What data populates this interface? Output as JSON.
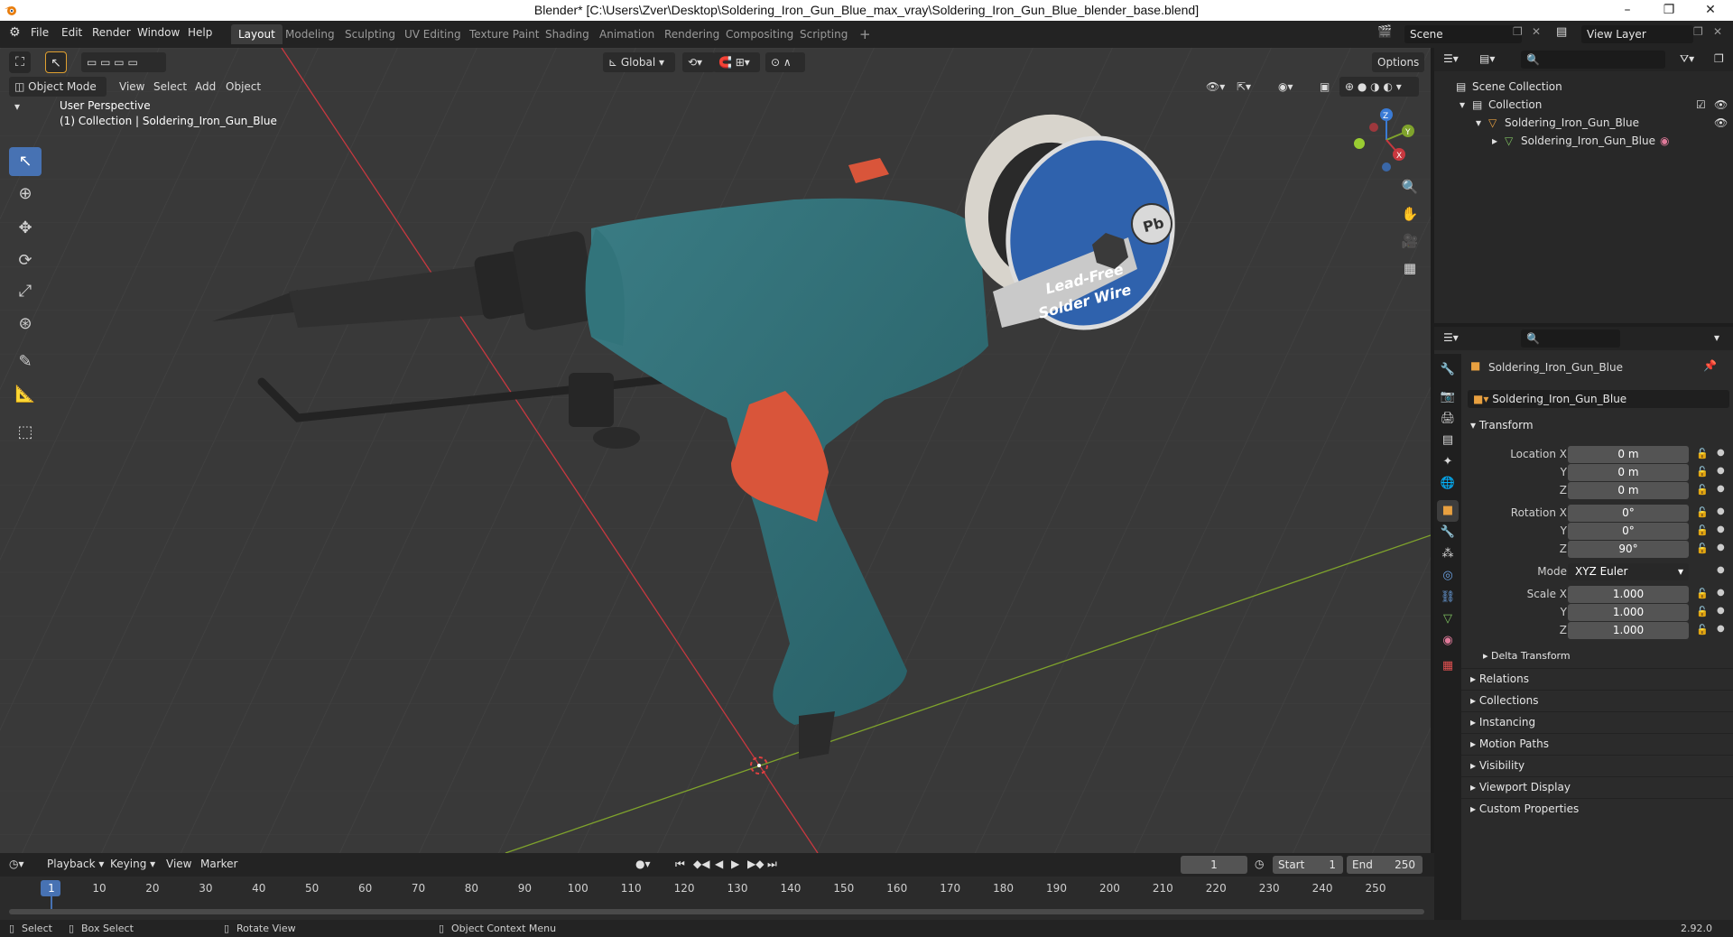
{
  "window": {
    "title": "Blender* [C:\\Users\\Zver\\Desktop\\Soldering_Iron_Gun_Blue_max_vray\\Soldering_Iron_Gun_Blue_blender_base.blend]",
    "minimize": "–",
    "restore": "❐",
    "close": "✕"
  },
  "menu": [
    "File",
    "Edit",
    "Render",
    "Window",
    "Help"
  ],
  "workspaces": [
    "Layout",
    "Modeling",
    "Sculpting",
    "UV Editing",
    "Texture Paint",
    "Shading",
    "Animation",
    "Rendering",
    "Compositing",
    "Scripting"
  ],
  "add_workspace": "+",
  "scene": {
    "name": "Scene",
    "view_layer": "View Layer"
  },
  "viewport": {
    "mode": "Object Mode",
    "menus": [
      "View",
      "Select",
      "Add",
      "Object"
    ],
    "transform_orientation": "Global",
    "options_label": "Options",
    "overlay_text": "User Perspective",
    "collection_text": "(1) Collection | Soldering_Iron_Gun_Blue",
    "axes": {
      "x": "X",
      "y": "Y",
      "z": "Z"
    }
  },
  "outliner": {
    "scene_collection": "Scene Collection",
    "collection": "Collection",
    "object": "Soldering_Iron_Gun_Blue",
    "mesh": "Soldering_Iron_Gun_Blue"
  },
  "properties": {
    "object_name": "Soldering_Iron_Gun_Blue",
    "datablock_name": "Soldering_Iron_Gun_Blue",
    "transform_header": "Transform",
    "location": {
      "label_x": "Location X",
      "label_y": "Y",
      "label_z": "Z",
      "x": "0 m",
      "y": "0 m",
      "z": "0 m"
    },
    "rotation": {
      "label_x": "Rotation X",
      "label_y": "Y",
      "label_z": "Z",
      "x": "0°",
      "y": "0°",
      "z": "90°"
    },
    "mode_label": "Mode",
    "mode_value": "XYZ Euler",
    "scale": {
      "label_x": "Scale X",
      "label_y": "Y",
      "label_z": "Z",
      "x": "1.000",
      "y": "1.000",
      "z": "1.000"
    },
    "delta_transform": "Delta Transform",
    "panels": [
      "Relations",
      "Collections",
      "Instancing",
      "Motion Paths",
      "Visibility",
      "Viewport Display",
      "Custom Properties"
    ]
  },
  "timeline": {
    "menus": [
      "Playback",
      "Keying",
      "View",
      "Marker"
    ],
    "current_frame": "1",
    "start_label": "Start",
    "start_value": "1",
    "end_label": "End",
    "end_value": "250",
    "ruler": [
      "1",
      "10",
      "20",
      "30",
      "40",
      "50",
      "60",
      "70",
      "80",
      "90",
      "100",
      "110",
      "120",
      "130",
      "140",
      "150",
      "160",
      "170",
      "180",
      "190",
      "200",
      "210",
      "220",
      "230",
      "240",
      "250"
    ]
  },
  "statusbar": {
    "select": "Select",
    "box_select": "Box Select",
    "rotate_view": "Rotate View",
    "context_menu": "Object Context Menu",
    "version": "2.92.0"
  },
  "spool_text": {
    "line1": "Lead-Free",
    "line2": "Solder Wire",
    "badge": "Pb"
  },
  "colors": {
    "accent": "#4772b3",
    "gun_body": "#2e6b72",
    "trigger": "#d9553a",
    "spool_blue": "#2f62ad",
    "x_axis": "#c8383f",
    "y_axis": "#7fa32c"
  }
}
